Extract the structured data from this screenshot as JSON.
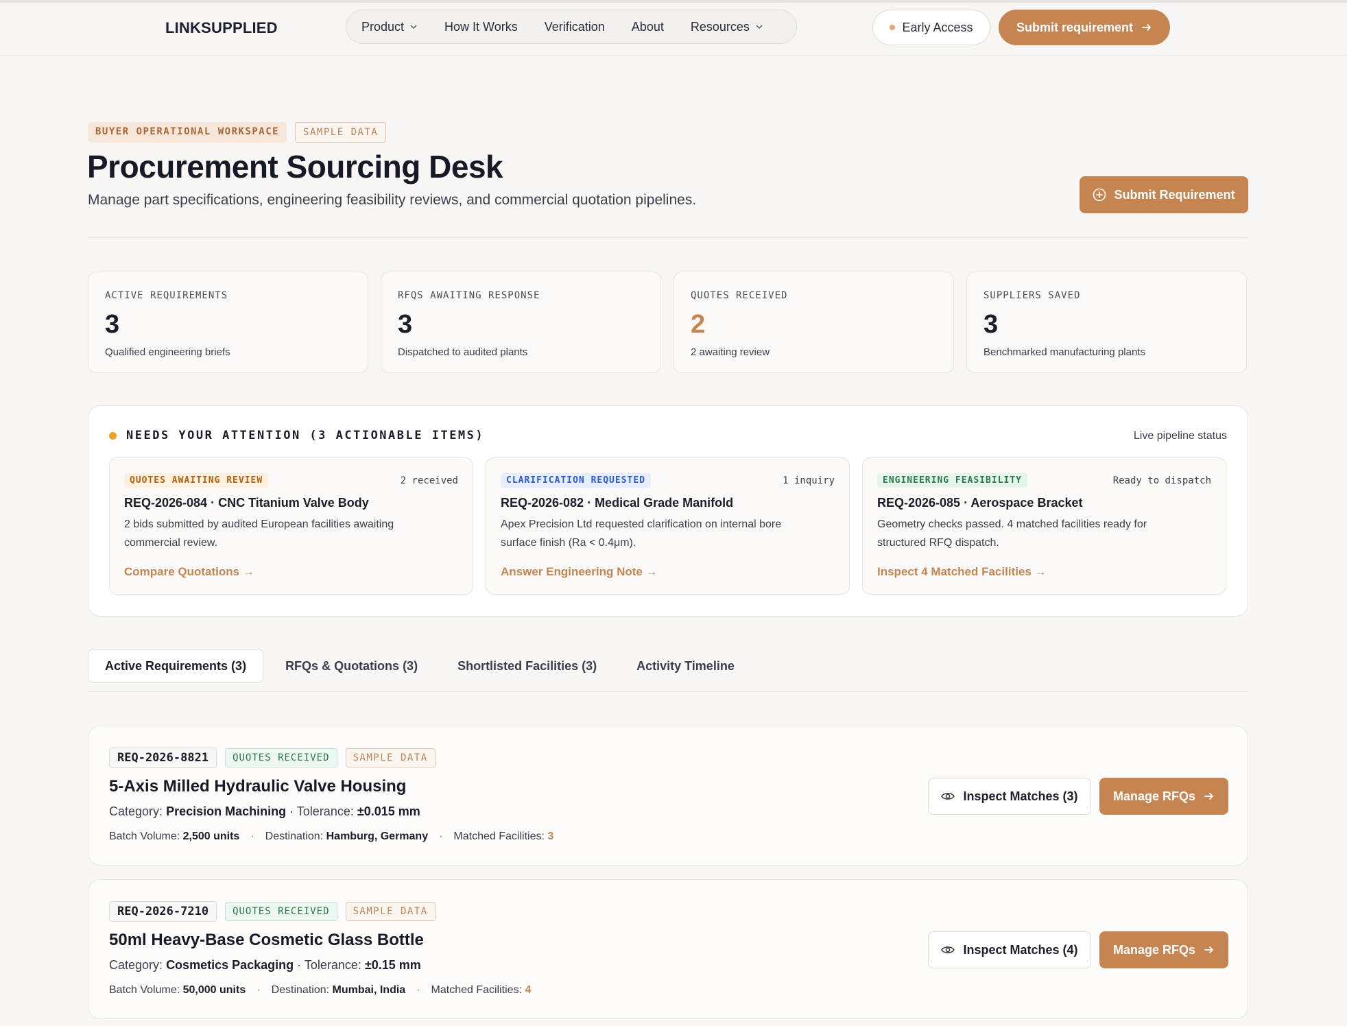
{
  "nav": {
    "logo": "LINKSUPPLIED",
    "items": [
      {
        "label": "Product",
        "dropdown": true
      },
      {
        "label": "How It Works",
        "dropdown": false
      },
      {
        "label": "Verification",
        "dropdown": false
      },
      {
        "label": "About",
        "dropdown": false
      },
      {
        "label": "Resources",
        "dropdown": true
      }
    ],
    "early_access": "Early Access",
    "submit_label": "Submit requirement"
  },
  "header": {
    "badge_workspace": "BUYER OPERATIONAL WORKSPACE",
    "badge_sample": "SAMPLE DATA",
    "title": "Procurement Sourcing Desk",
    "subtitle": "Manage part specifications, engineering feasibility reviews, and commercial quotation pipelines.",
    "submit_label": "Submit Requirement"
  },
  "stats": [
    {
      "label": "ACTIVE REQUIREMENTS",
      "value": "3",
      "desc": "Qualified engineering briefs"
    },
    {
      "label": "RFQS AWAITING RESPONSE",
      "value": "3",
      "desc": "Dispatched to audited plants"
    },
    {
      "label": "QUOTES RECEIVED",
      "value": "2",
      "desc": "2 awaiting review"
    },
    {
      "label": "SUPPLIERS SAVED",
      "value": "3",
      "desc": "Benchmarked manufacturing plants"
    }
  ],
  "attention": {
    "title": "NEEDS YOUR ATTENTION (3 ACTIONABLE ITEMS)",
    "live": "Live pipeline status",
    "cards": [
      {
        "tag": "QUOTES AWAITING REVIEW",
        "meta": "2 received",
        "name": "REQ-2026-084 · CNC Titanium Valve Body",
        "text": "2 bids submitted by audited European facilities awaiting commercial review.",
        "link": "Compare Quotations →"
      },
      {
        "tag": "CLARIFICATION REQUESTED",
        "meta": "1 inquiry",
        "name": "REQ-2026-082 · Medical Grade Manifold",
        "text": "Apex Precision Ltd requested clarification on internal bore surface finish (Ra < 0.4μm).",
        "link": "Answer Engineering Note →"
      },
      {
        "tag": "ENGINEERING FEASIBILITY",
        "meta": "Ready to dispatch",
        "name": "REQ-2026-085 · Aerospace Bracket",
        "text": "Geometry checks passed. 4 matched facilities ready for structured RFQ dispatch.",
        "link": "Inspect 4 Matched Facilities →"
      }
    ]
  },
  "tabs": [
    "Active Requirements (3)",
    "RFQs & Quotations (3)",
    "Shortlisted Facilities (3)",
    "Activity Timeline"
  ],
  "requirements": [
    {
      "id": "REQ-2026-8821",
      "status": "QUOTES RECEIVED",
      "sample": "SAMPLE DATA",
      "title": "5-Axis Milled Hydraulic Valve Housing",
      "category_label": "Category:",
      "category": "Precision Machining",
      "tolerance_label": "· Tolerance:",
      "tolerance": "±0.015 mm",
      "batch_label": "Batch Volume:",
      "batch": "2,500 units",
      "dest_label": "Destination:",
      "dest": "Hamburg, Germany",
      "matched_label": "Matched Facilities:",
      "matched": "3",
      "inspect_label": "Inspect Matches (3)",
      "manage_label": "Manage RFQs"
    },
    {
      "id": "REQ-2026-7210",
      "status": "QUOTES RECEIVED",
      "sample": "SAMPLE DATA",
      "title": "50ml Heavy-Base Cosmetic Glass Bottle",
      "category_label": "Category:",
      "category": "Cosmetics Packaging",
      "tolerance_label": "· Tolerance:",
      "tolerance": "±0.15 mm",
      "batch_label": "Batch Volume:",
      "batch": "50,000 units",
      "dest_label": "Destination:",
      "dest": "Mumbai, India",
      "matched_label": "Matched Facilities:",
      "matched": "4",
      "inspect_label": "Inspect Matches (4)",
      "manage_label": "Manage RFQs"
    }
  ],
  "icons": {
    "chevron": "chevron-down-icon",
    "arrow": "arrow-right-icon",
    "plus_circle": "plus-circle-icon",
    "eye": "eye-icon"
  },
  "colors": {
    "accent": "#c68550",
    "attention_dot": "#f1a022"
  }
}
